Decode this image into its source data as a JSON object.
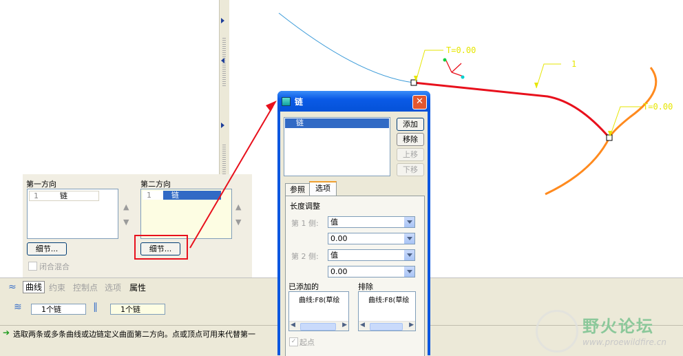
{
  "viewport": {
    "t0_label_1": "T=0.00",
    "one_label": "1",
    "t0_label_2": "T=0.00"
  },
  "sections": {
    "first_direction": "第一方向",
    "second_direction": "第二方向",
    "first_list": {
      "index": "1",
      "item": "链"
    },
    "second_list": {
      "index": "1",
      "item": "链"
    },
    "details_button_1": "细节...",
    "details_button_2": "细节...",
    "closed_blend": "闭合混合"
  },
  "dashboard": {
    "tabs": [
      "曲线",
      "约束",
      "控制点",
      "选项",
      "属性"
    ],
    "first_chain_field": "1个链",
    "second_chain_field": "1个链",
    "status_message": "选取两条或多条曲线或边链定义曲面第二方向。点或顶点可用来代替第一"
  },
  "dialog": {
    "title": "链",
    "list_item": "链",
    "buttons": {
      "add": "添加",
      "remove": "移除",
      "move_up": "上移",
      "move_down": "下移"
    },
    "tabs": {
      "reference": "参照",
      "options": "选项"
    },
    "length_adjust": "长度调整",
    "side1_label": "第 1 侧:",
    "side1_type": "值",
    "side1_value": "0.00",
    "side2_label": "第 2 侧:",
    "side2_type": "值",
    "side2_value": "0.00",
    "added_label": "已添加的",
    "excluded_label": "排除",
    "added_item": "曲线:F8(草绘",
    "excluded_item": "曲线:F8(草绘",
    "start_point": "起点"
  },
  "watermark": {
    "brand": "野火论坛",
    "url": "www.proewildfire.cn"
  },
  "colors": {
    "accent_red": "#e8101c",
    "curve_orange": "#ff8a1e",
    "curve_blue": "#3a9ad8",
    "label_yellow": "#e6e600",
    "xp_title_blue": "#0a56e0"
  }
}
